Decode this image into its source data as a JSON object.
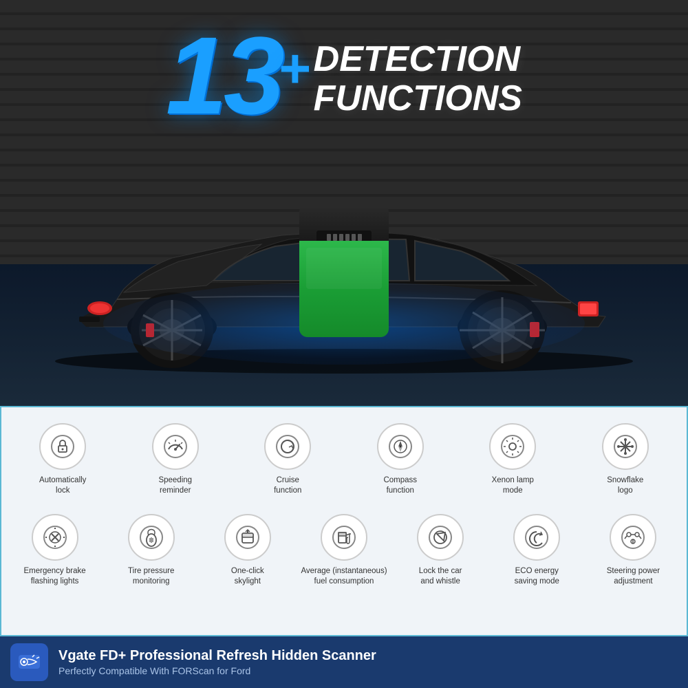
{
  "heading": {
    "number": "13",
    "plus": "+",
    "line1": "DETECTION",
    "line2": "FUNCTIONS"
  },
  "features_row1": [
    {
      "id": "auto-lock",
      "icon": "🔒",
      "label": "Automatically\nlock"
    },
    {
      "id": "speeding",
      "icon": "⏱",
      "label": "Speeding\nreminder"
    },
    {
      "id": "cruise",
      "icon": "↻",
      "label": "Cruise\nfunction"
    },
    {
      "id": "compass",
      "icon": "🧭",
      "label": "Compass\nfunction"
    },
    {
      "id": "xenon",
      "icon": "💡",
      "label": "Xenon lamp\nmode"
    },
    {
      "id": "snowflake",
      "icon": "❄",
      "label": "Snowflake\nlogo"
    }
  ],
  "features_row2": [
    {
      "id": "emergency-brake",
      "icon": "⚡",
      "label": "Emergency brake\nflashing lights"
    },
    {
      "id": "tire-pressure",
      "icon": "〰",
      "label": "Tire pressure\nmonitoring"
    },
    {
      "id": "skylight",
      "icon": "🪟",
      "label": "One-click\nskylight"
    },
    {
      "id": "fuel",
      "icon": "⛽",
      "label": "Average (instantaneous)\nfuel consumption"
    },
    {
      "id": "lock-whistle",
      "icon": "🎵",
      "label": "Lock the car\nand whistle"
    },
    {
      "id": "eco",
      "icon": "♻",
      "label": "ECO energy\nsaving mode"
    },
    {
      "id": "steering",
      "icon": "⚙",
      "label": "Steering power\nadjustment"
    }
  ],
  "footer": {
    "title": "Vgate FD+ Professional Refresh Hidden Scanner",
    "subtitle": "Perfectly Compatible With FORScan for Ford"
  }
}
